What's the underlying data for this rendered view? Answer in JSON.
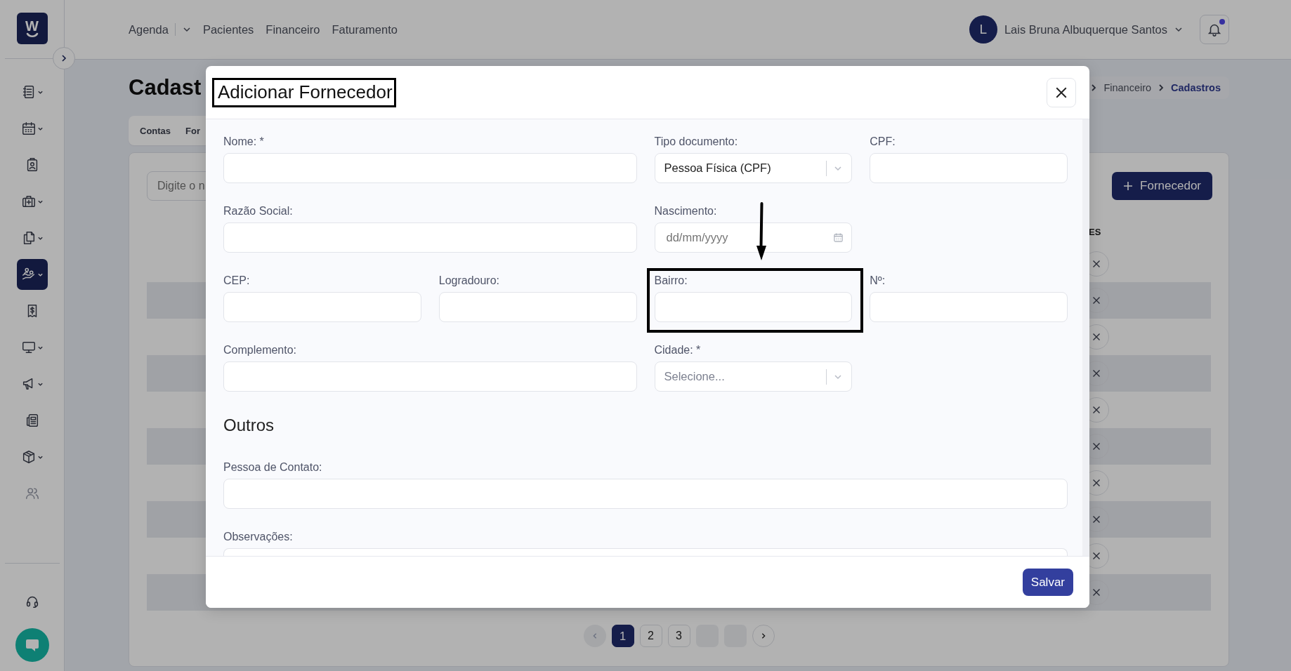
{
  "logo": {
    "letter": "W"
  },
  "sidebar": {
    "items": [
      {
        "selected": false,
        "submenu": true,
        "disabled": false
      },
      {
        "selected": false,
        "submenu": true,
        "disabled": false
      },
      {
        "selected": false,
        "submenu": false,
        "disabled": false
      },
      {
        "selected": false,
        "submenu": true,
        "disabled": false
      },
      {
        "selected": false,
        "submenu": true,
        "disabled": false
      },
      {
        "selected": true,
        "submenu": true,
        "disabled": false
      },
      {
        "selected": false,
        "submenu": false,
        "disabled": false
      },
      {
        "selected": false,
        "submenu": true,
        "disabled": false
      },
      {
        "selected": false,
        "submenu": true,
        "disabled": false
      },
      {
        "selected": false,
        "submenu": false,
        "disabled": false
      },
      {
        "selected": false,
        "submenu": true,
        "disabled": false
      },
      {
        "selected": false,
        "submenu": false,
        "disabled": true
      }
    ]
  },
  "top_nav": {
    "links": [
      {
        "label": "Agenda",
        "dropdown": true
      },
      {
        "label": "Pacientes",
        "dropdown": false
      },
      {
        "label": "Financeiro",
        "dropdown": false
      },
      {
        "label": "Faturamento",
        "dropdown": false
      }
    ]
  },
  "user": {
    "initial": "L",
    "name": "Lais Bruna Albuquerque Santos"
  },
  "notifications": {
    "unread": true
  },
  "page": {
    "title": "Cadast",
    "tabs": [
      {
        "label": "Contas"
      },
      {
        "label": "For"
      }
    ],
    "breadcrumb": [
      {
        "label": "Financeiro",
        "current": false
      },
      {
        "label": "Cadastros",
        "current": true
      }
    ],
    "search": {
      "placeholder": "Digite o n"
    },
    "add_button": {
      "label": "Fornecedor"
    },
    "table": {
      "columns": [
        "ES"
      ],
      "rows": [
        {
          "striped": false
        },
        {
          "striped": true
        },
        {
          "striped": false
        },
        {
          "striped": true
        },
        {
          "striped": false
        },
        {
          "striped": true
        },
        {
          "striped": false
        },
        {
          "striped": true
        },
        {
          "striped": false
        },
        {
          "striped": true
        }
      ]
    },
    "pagination": {
      "prev": {
        "disabled": true
      },
      "next": {
        "disabled": false
      },
      "pages": [
        {
          "kind": "page",
          "label": "1",
          "selected": true
        },
        {
          "kind": "page",
          "label": "2",
          "selected": false
        },
        {
          "kind": "page",
          "label": "3",
          "selected": false
        },
        {
          "kind": "blank",
          "selected": false
        },
        {
          "kind": "blank",
          "selected": false
        }
      ]
    }
  },
  "modal": {
    "title": "Adicionar Fornecedor",
    "title_highlighted": true,
    "fields": [
      {
        "label": "Nome: *",
        "kind": "text"
      },
      {
        "label": "Tipo documento:",
        "kind": "select",
        "value": "Pessoa Física (CPF)"
      },
      {
        "label": "CPF:",
        "kind": "text"
      },
      {
        "label": "Razão Social:",
        "kind": "text"
      },
      {
        "label": "Nascimento:",
        "kind": "date",
        "placeholder": "dd/mm/yyyy"
      },
      {
        "label": "CEP:",
        "kind": "text"
      },
      {
        "label": "Logradouro:",
        "kind": "text"
      },
      {
        "label": "Bairro:",
        "kind": "text",
        "highlighted": true
      },
      {
        "label": "Nº:",
        "kind": "text"
      },
      {
        "label": "Complemento:",
        "kind": "text"
      },
      {
        "label": "Cidade: *",
        "kind": "select",
        "placeholder": "Selecione..."
      }
    ],
    "section": {
      "title": "Outros",
      "fields": [
        {
          "label": "Pessoa de Contato:",
          "kind": "text"
        },
        {
          "label": "Observações:",
          "kind": "textarea"
        }
      ]
    },
    "save_button": "Salvar"
  }
}
